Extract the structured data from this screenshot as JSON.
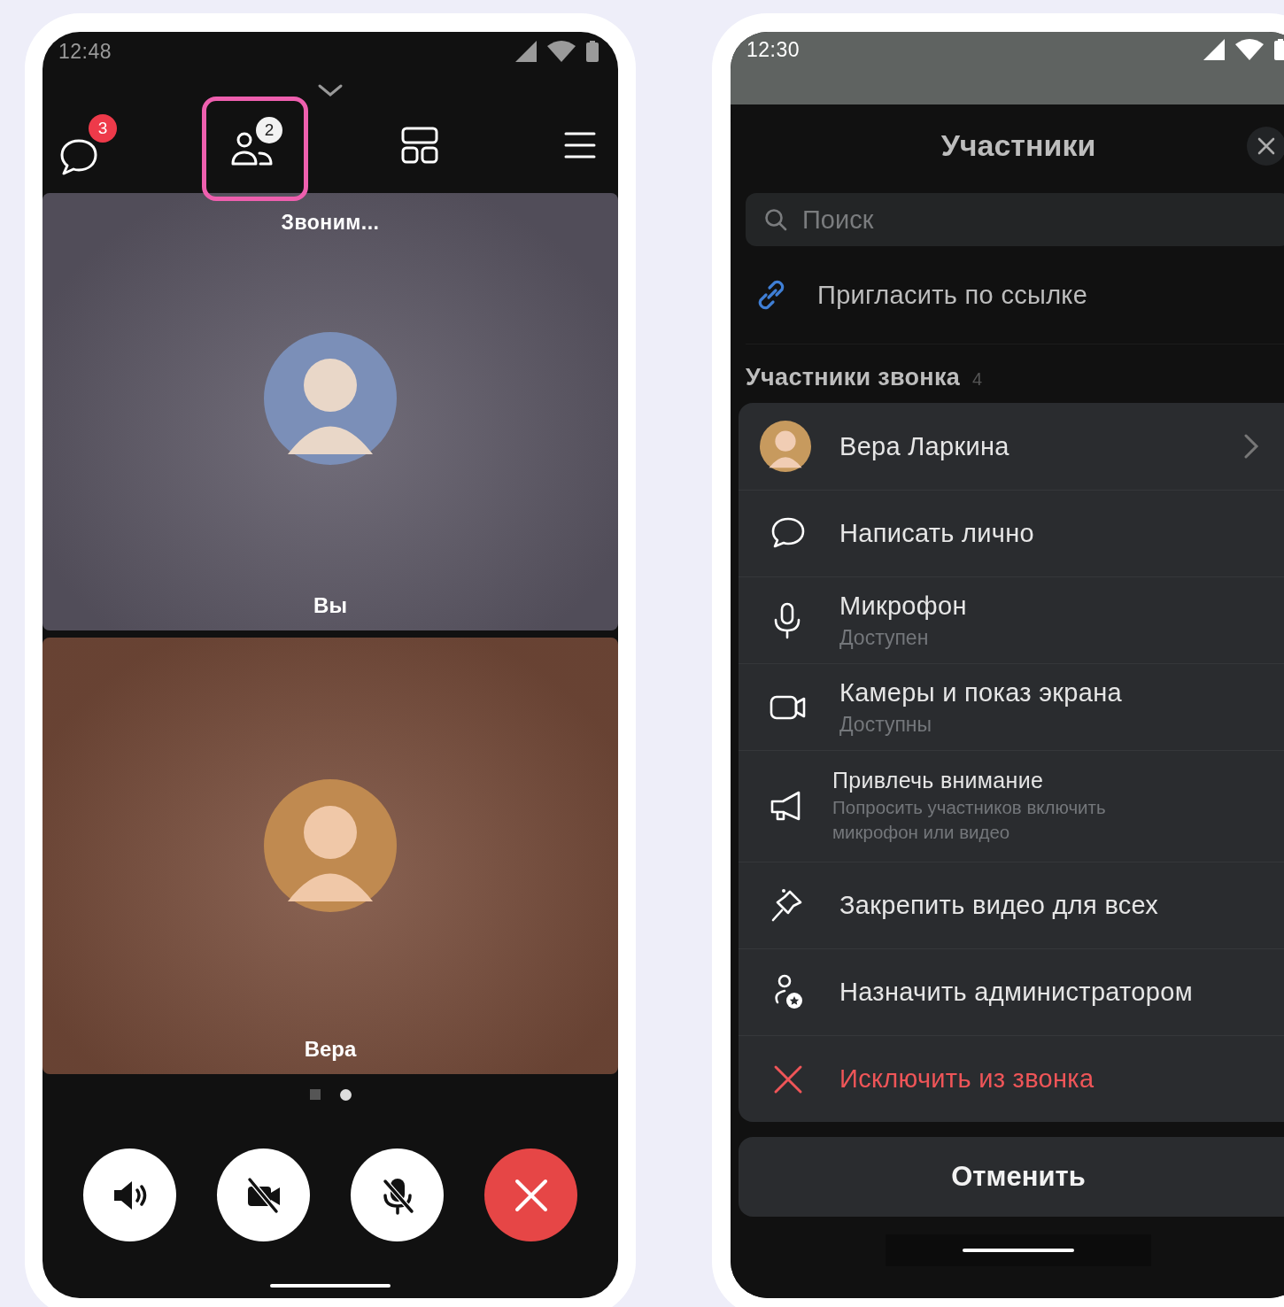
{
  "call_screen": {
    "status_bar": {
      "time": "12:48"
    },
    "toolbar": [
      {
        "kind": "chat",
        "badge": "3"
      },
      {
        "kind": "participants",
        "badge": "2",
        "highlighted": true
      },
      {
        "kind": "layout"
      },
      {
        "kind": "menu"
      }
    ],
    "tiles": [
      {
        "status": "Звоним...",
        "name": "Вы",
        "color": "#5f5a68"
      },
      {
        "name": "Вера",
        "color": "#7a4e3c"
      }
    ],
    "pages": [
      {
        "kind": "grid",
        "selected": false
      },
      {
        "kind": "dot",
        "selected": true
      }
    ],
    "controls": [
      {
        "kind": "speaker"
      },
      {
        "kind": "camera_off"
      },
      {
        "kind": "mic_off"
      },
      {
        "kind": "hangup"
      }
    ]
  },
  "participants_screen": {
    "status_bar": {
      "time": "12:30"
    },
    "title": "Участники",
    "search": {
      "placeholder": "Поиск"
    },
    "invite": "Пригласить по ссылке",
    "section": {
      "title": "Участники звонка",
      "count": "4"
    },
    "menu": [
      {
        "kind": "profile",
        "label": "Вера Ларкина"
      },
      {
        "kind": "action",
        "label": "Написать лично"
      },
      {
        "kind": "action",
        "label": "Микрофон",
        "subtitle": "Доступен"
      },
      {
        "kind": "action",
        "label": "Камеры и показ экрана",
        "subtitle": "Доступны"
      },
      {
        "kind": "notice",
        "label": "Привлечь внимание",
        "subtitle": "Попросить участников включить микрофон или видео"
      },
      {
        "kind": "action",
        "label": "Закрепить видео для всех"
      },
      {
        "kind": "action",
        "label": "Назначить администратором"
      },
      {
        "kind": "danger",
        "label": "Исключить из звонка"
      }
    ],
    "cancel": "Отменить"
  }
}
